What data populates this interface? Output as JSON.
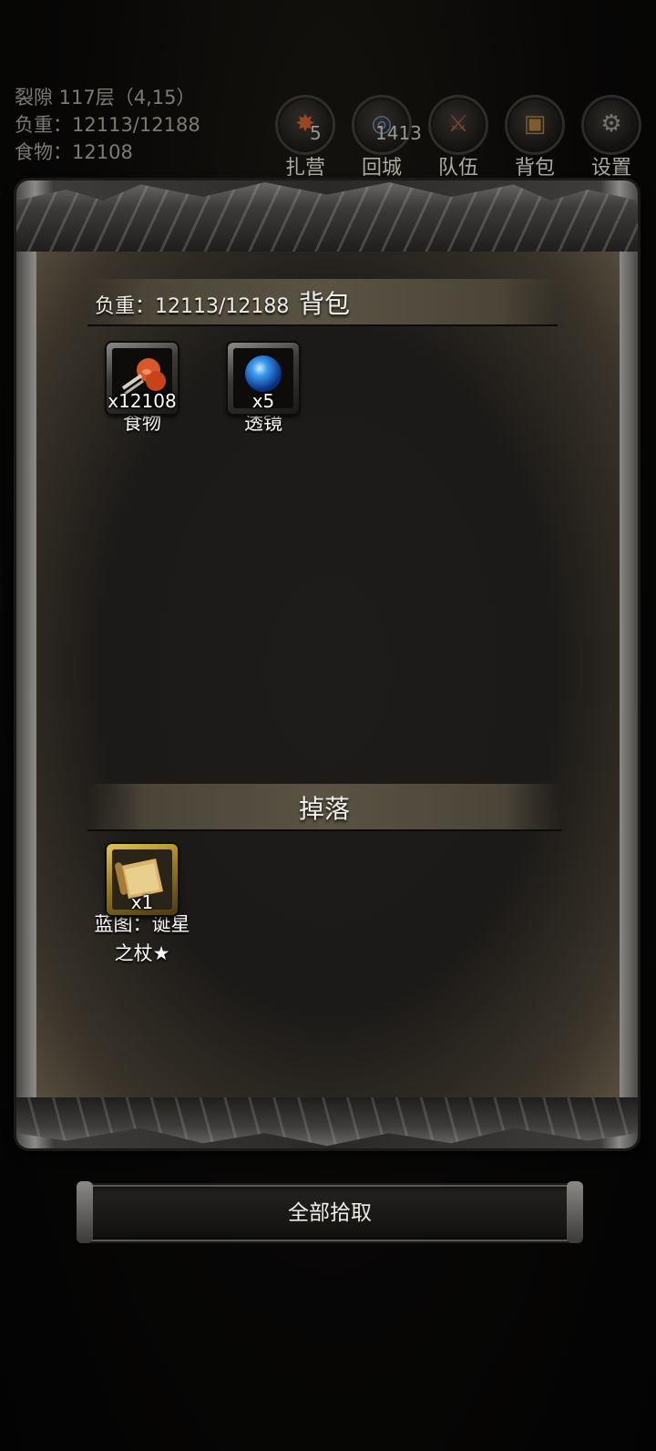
{
  "status": {
    "location": "裂隙 117层（4,15）",
    "weight": "负重：12113/12188",
    "food": "食物：12108"
  },
  "menu": {
    "items": [
      {
        "label": "扎营",
        "count": "5",
        "icon": "campfire-icon"
      },
      {
        "label": "回城",
        "count": "1413",
        "icon": "portal-icon"
      },
      {
        "label": "队伍",
        "icon": "team-icon"
      },
      {
        "label": "背包",
        "icon": "backpack-icon"
      },
      {
        "label": "设置",
        "icon": "gear-icon"
      }
    ]
  },
  "bag": {
    "title": "背包",
    "weight": "负重：12113/12188",
    "items": [
      {
        "name": "食物",
        "qty": "x12108",
        "icon": "meat-icon"
      },
      {
        "name": "透镜",
        "qty": "x5",
        "icon": "lens-orb-icon"
      }
    ]
  },
  "drop": {
    "title": "掉落",
    "items": [
      {
        "name_line1": "蓝图：诞星",
        "name_line2": "之杖★",
        "qty": "x1",
        "icon": "blueprint-scroll-icon"
      }
    ]
  },
  "actions": {
    "pickup_all": "全部拾取"
  }
}
